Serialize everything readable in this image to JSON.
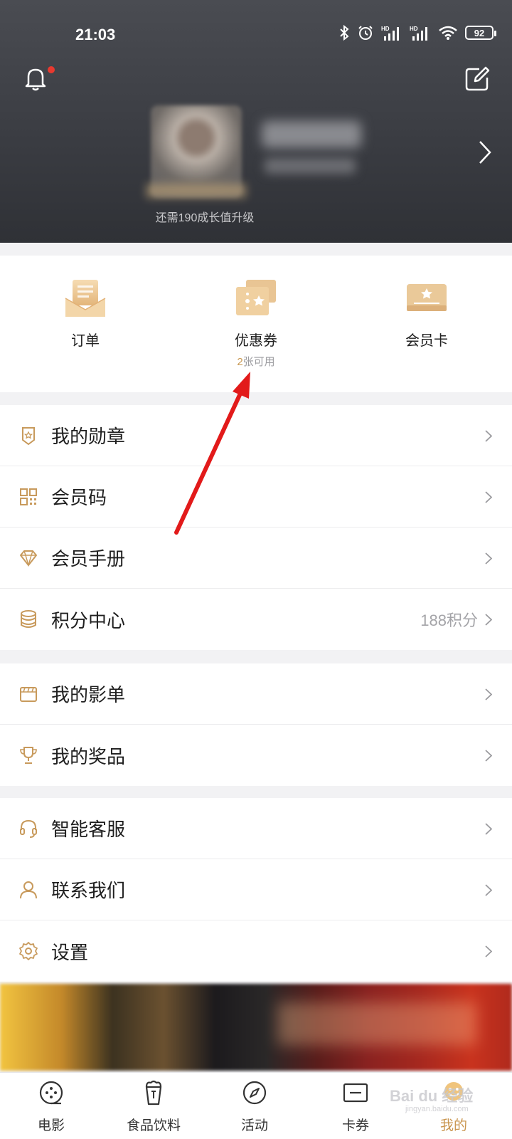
{
  "status_bar": {
    "time": "21:03",
    "battery": "92"
  },
  "header": {
    "upgrade_text": "还需190成长值升级"
  },
  "quick_actions": [
    {
      "label": "订单",
      "sub": ""
    },
    {
      "label": "优惠券",
      "sub_count": "2",
      "sub_text": "张可用"
    },
    {
      "label": "会员卡",
      "sub": ""
    }
  ],
  "menu": {
    "group1": [
      {
        "label": "我的勋章",
        "icon": "medal-icon"
      },
      {
        "label": "会员码",
        "icon": "qr-code-icon"
      },
      {
        "label": "会员手册",
        "icon": "diamond-icon"
      },
      {
        "label": "积分中心",
        "icon": "coins-icon",
        "value": "188积分"
      }
    ],
    "group2": [
      {
        "label": "我的影单",
        "icon": "clapperboard-icon"
      },
      {
        "label": "我的奖品",
        "icon": "trophy-icon"
      }
    ],
    "group3": [
      {
        "label": "智能客服",
        "icon": "headset-icon"
      },
      {
        "label": "联系我们",
        "icon": "person-icon"
      },
      {
        "label": "设置",
        "icon": "gear-icon"
      }
    ]
  },
  "bottom_nav": [
    {
      "label": "电影"
    },
    {
      "label": "食品饮料"
    },
    {
      "label": "活动"
    },
    {
      "label": "卡券"
    },
    {
      "label": "我的"
    }
  ],
  "watermark": {
    "text": "Bai du 经验",
    "sub": "jingyan.baidu.com"
  },
  "colors": {
    "accent": "#c9954e",
    "header_dark": "#3b3d43",
    "annotation_red": "#e21a1a"
  }
}
